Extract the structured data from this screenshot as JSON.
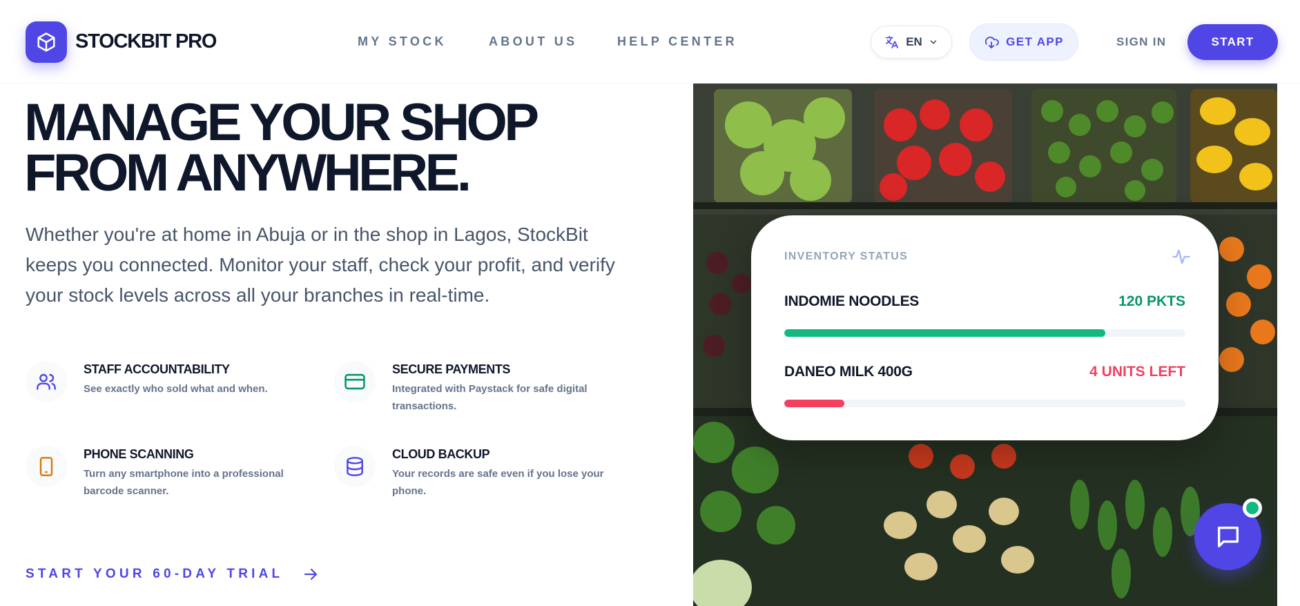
{
  "brand": {
    "name": "STOCKBIT PRO",
    "logo_icon": "cube-icon",
    "accent": "#4f46e5"
  },
  "nav": {
    "links": [
      "MY STOCK",
      "ABOUT US",
      "HELP CENTER"
    ],
    "language": "EN",
    "get_app": "GET APP",
    "sign_in": "SIGN IN",
    "start": "START"
  },
  "hero": {
    "title_line1": "MANAGE YOUR SHOP",
    "title_line2": "FROM ANYWHERE.",
    "description": "Whether you're at home in Abuja or in the shop in Lagos, StockBit keeps you connected. Monitor your staff, check your profit, and verify your stock levels across all your branches in real-time."
  },
  "features": [
    {
      "title": "STAFF ACCOUNTABILITY",
      "desc": "See exactly who sold what and when.",
      "icon": "users-icon",
      "color": "#4f46e5"
    },
    {
      "title": "SECURE PAYMENTS",
      "desc": "Integrated with Paystack for safe digital transactions.",
      "icon": "credit-card-icon",
      "color": "#059669"
    },
    {
      "title": "PHONE SCANNING",
      "desc": "Turn any smartphone into a professional barcode scanner.",
      "icon": "smartphone-icon",
      "color": "#d97706"
    },
    {
      "title": "CLOUD BACKUP",
      "desc": "Your records are safe even if you lose your phone.",
      "icon": "database-icon",
      "color": "#4f46e5"
    }
  ],
  "cta": {
    "trial": "START YOUR 60-DAY TRIAL"
  },
  "inventory": {
    "label": "INVENTORY STATUS",
    "items": [
      {
        "name": "INDOMIE NOODLES",
        "qty": "120 PKTS",
        "level": 0.8,
        "color": "#10b981"
      },
      {
        "name": "DANEO MILK 400G",
        "qty": "4 UNITS LEFT",
        "level": 0.15,
        "color": "#f43f5e"
      }
    ]
  },
  "colors": {
    "success": "#10b981",
    "danger": "#f43f5e",
    "text_dark": "#0f172a",
    "text_muted": "#64748b"
  }
}
